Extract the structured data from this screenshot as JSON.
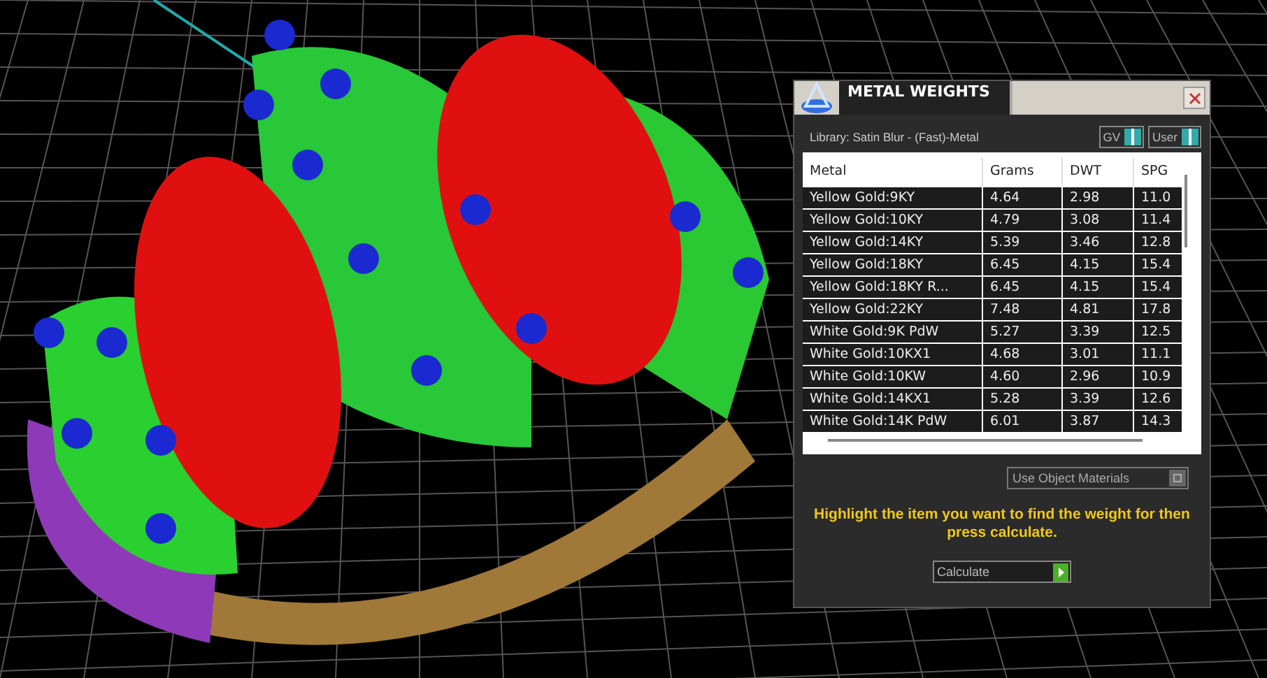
{
  "panel": {
    "title": "METAL WEIGHTS",
    "library": "Library: Satin Blur - (Fast)-Metal",
    "toggles": [
      {
        "label": "GV",
        "on": true
      },
      {
        "label": "User",
        "on": true
      }
    ],
    "table": {
      "columns": [
        "Metal",
        "Grams",
        "DWT",
        "SPG"
      ],
      "rows": [
        [
          "Yellow Gold:9KY",
          "4.64",
          "2.98",
          "11.0"
        ],
        [
          "Yellow Gold:10KY",
          "4.79",
          "3.08",
          "11.4"
        ],
        [
          "Yellow Gold:14KY",
          "5.39",
          "3.46",
          "12.8"
        ],
        [
          "Yellow Gold:18KY",
          "6.45",
          "4.15",
          "15.4"
        ],
        [
          "Yellow Gold:18KY R...",
          "6.45",
          "4.15",
          "15.4"
        ],
        [
          "Yellow Gold:22KY",
          "7.48",
          "4.81",
          "17.8"
        ],
        [
          "White Gold:9K PdW",
          "5.27",
          "3.39",
          "12.5"
        ],
        [
          "White Gold:10KX1",
          "4.68",
          "3.01",
          "11.1"
        ],
        [
          "White Gold:10KW",
          "4.60",
          "2.96",
          "10.9"
        ],
        [
          "White Gold:14KX1",
          "5.28",
          "3.39",
          "12.6"
        ],
        [
          "White Gold:14K PdW",
          "6.01",
          "3.87",
          "14.3"
        ]
      ]
    },
    "object_materials": {
      "label": "Use Object Materials",
      "checked": false
    },
    "hint": "Highlight the item you want to find the weight for then press calculate.",
    "calculate_button": "Calculate"
  }
}
